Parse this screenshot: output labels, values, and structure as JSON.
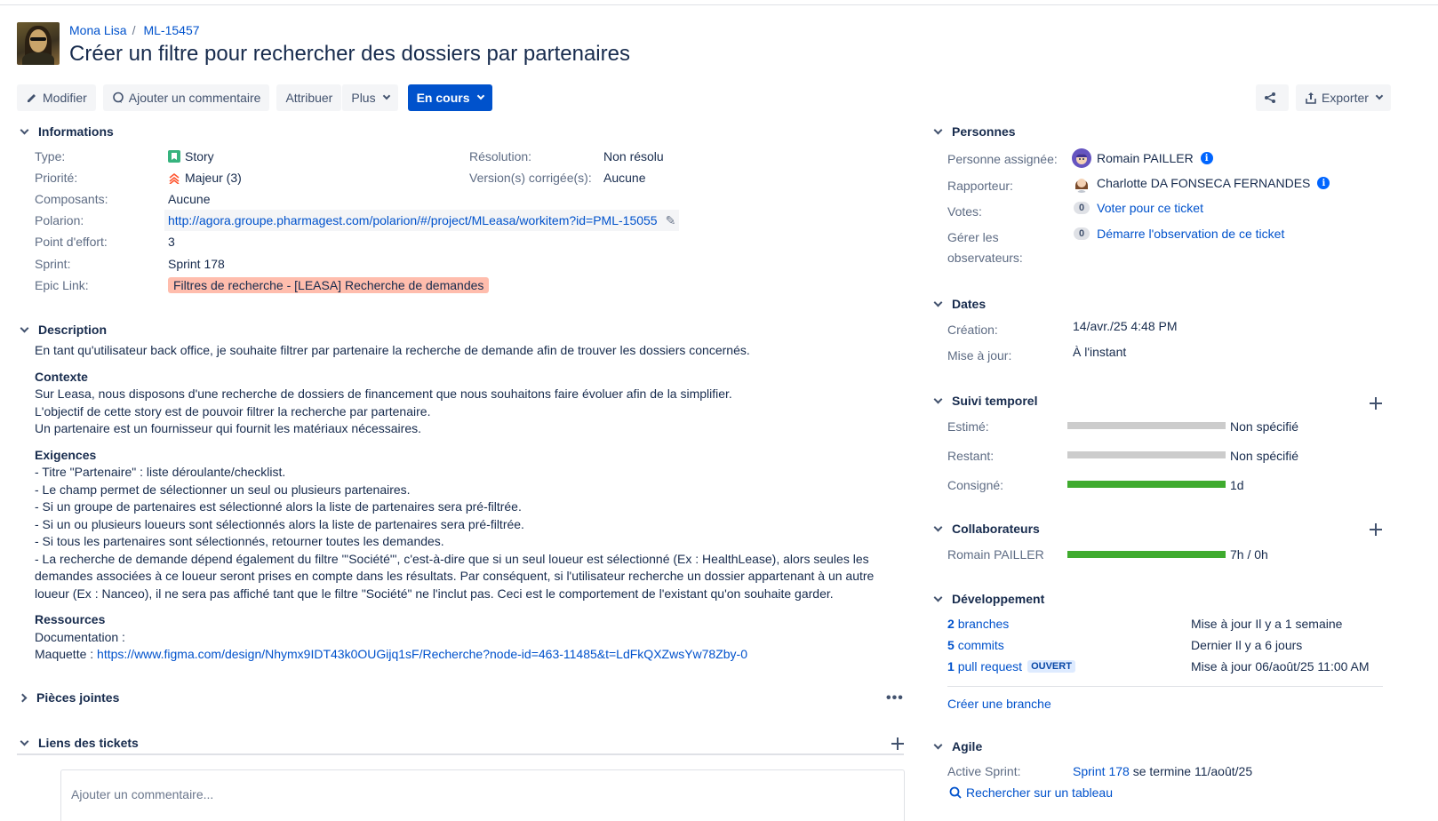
{
  "breadcrumb": {
    "project": "Mona Lisa",
    "issue_key": "ML-15457"
  },
  "title": "Créer un filtre pour rechercher des dossiers par partenaires",
  "toolbar": {
    "edit": "Modifier",
    "comment": "Ajouter un commentaire",
    "assign": "Attribuer",
    "more": "Plus",
    "status": "En cours",
    "export": "Exporter"
  },
  "details": {
    "header": "Informations",
    "type_label": "Type:",
    "type_value": "Story",
    "priority_label": "Priorité:",
    "priority_value": "Majeur (3)",
    "components_label": "Composants:",
    "components_value": "Aucune",
    "polarion_label": "Polarion:",
    "polarion_value": "http://agora.groupe.pharmagest.com/polarion/#/project/MLeasa/workitem?id=PML-15055",
    "effort_label": "Point d'effort:",
    "effort_value": "3",
    "sprint_label": "Sprint:",
    "sprint_value": "Sprint 178",
    "epic_label": "Epic Link:",
    "epic_value": "Filtres de recherche - [LEASA] Recherche de demandes",
    "resolution_label": "Résolution:",
    "resolution_value": "Non résolu",
    "fixversion_label": "Version(s) corrigée(s):",
    "fixversion_value": "Aucune"
  },
  "description": {
    "header": "Description",
    "intro": "En tant qu'utilisateur back office, je souhaite filtrer par partenaire la recherche de demande afin de trouver les dossiers concernés.",
    "context_title": "Contexte",
    "context_lines": [
      "Sur Leasa, nous disposons d'une recherche de dossiers de financement que nous souhaitons faire évoluer afin de la simplifier.",
      "L'objectif de cette story est de pouvoir filtrer la recherche par partenaire.",
      "Un partenaire est un fournisseur qui fournit les matériaux nécessaires."
    ],
    "req_title": "Exigences",
    "req_lines": [
      "- Titre \"Partenaire\" : liste déroulante/checklist.",
      "- Le champ permet de sélectionner un seul ou plusieurs partenaires.",
      "- Si un groupe de partenaires est sélectionné alors la liste de partenaires sera pré-filtrée.",
      "- Si un ou plusieurs loueurs sont sélectionnés alors la liste de partenaires sera pré-filtrée.",
      "- Si tous les partenaires sont sélectionnés, retourner toutes les demandes.",
      "- La recherche de demande dépend également du filtre \"'Société\"', c'est-à-dire que si un seul loueur est sélectionné (Ex : HealthLease), alors seules les demandes associées à ce loueur seront prises en compte dans les résultats. Par conséquent, si l'utilisateur recherche un dossier appartenant à un autre loueur (Ex : Nanceo), il ne sera pas affiché tant que le filtre \"Société\" ne l'inclut pas. Ceci est le comportement de l'existant qu'on souhaite garder."
    ],
    "res_title": "Ressources",
    "doc_label": "Documentation :",
    "maquette_label": "Maquette : ",
    "maquette_link": "https://www.figma.com/design/Nhymx9IDT43k0OUGijq1sF/Recherche?node-id=463-11485&t=LdFkQXZwsYw78Zby-0"
  },
  "attachments_header": "Pièces jointes",
  "links_header": "Liens des tickets",
  "comment_placeholder": "Ajouter un commentaire...",
  "people": {
    "header": "Personnes",
    "assignee_label": "Personne assignée:",
    "assignee_value": "Romain PAILLER",
    "reporter_label": "Rapporteur:",
    "reporter_value": "Charlotte DA FONSECA FERNANDES",
    "votes_label": "Votes:",
    "votes_count": "0",
    "votes_link": "Voter pour ce ticket",
    "watchers_label_1": "Gérer les",
    "watchers_label_2": "observateurs:",
    "watchers_count": "0",
    "watchers_link": "Démarre l'observation de ce ticket"
  },
  "dates": {
    "header": "Dates",
    "created_label": "Création:",
    "created_value": "14/avr./25 4:48 PM",
    "updated_label": "Mise à jour:",
    "updated_value": "À l'instant"
  },
  "time_tracking": {
    "header": "Suivi temporel",
    "estimated_label": "Estimé:",
    "estimated_value": "Non spécifié",
    "estimated_fill": 0,
    "remaining_label": "Restant:",
    "remaining_value": "Non spécifié",
    "remaining_fill": 0,
    "logged_label": "Consigné:",
    "logged_value": "1d",
    "logged_fill": 1
  },
  "collaborators": {
    "header": "Collaborateurs",
    "name": "Romain PAILLER",
    "value": "7h / 0h",
    "fill": 1
  },
  "development": {
    "header": "Développement",
    "branches_count": "2",
    "branches_label": "branches",
    "branches_status": "Mise à jour Il y a 1 semaine",
    "commits_count": "5",
    "commits_label": "commits",
    "commits_status": "Dernier Il y a 6 jours",
    "pr_count": "1",
    "pr_label": "pull request",
    "pr_badge": "OUVERT",
    "pr_status": "Mise à jour 06/août/25 11:00 AM",
    "create_branch": "Créer une branche"
  },
  "agile": {
    "header": "Agile",
    "active_sprint_label": "Active Sprint:",
    "sprint_link": "Sprint 178",
    "sprint_end": " se termine 11/août/25",
    "board_link": "Rechercher sur un tableau"
  },
  "colors": {
    "primary": "#0052cc",
    "epic_bg": "#ffbdad",
    "bar_fill": "#3fab2e",
    "bar_empty": "#cccccc"
  }
}
